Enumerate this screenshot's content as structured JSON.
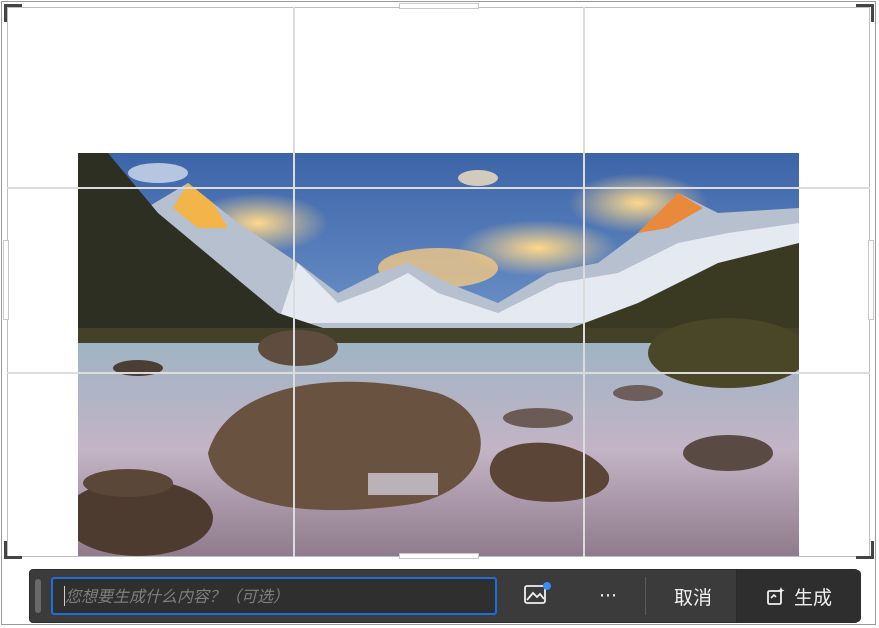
{
  "prompt": {
    "placeholder": "您想要生成什么内容？（可选）",
    "value": ""
  },
  "toolbar": {
    "reference_icon": "image-reference-icon",
    "more_icon": "more-horizontal-icon",
    "more_label": "···",
    "cancel_label": "取消",
    "generate_label": "生成",
    "generate_icon": "generate-sparkle-icon"
  },
  "colors": {
    "toolbar_bg": "#3b3b3b",
    "input_focus_border": "#1e6fd6",
    "badge_dot": "#3b8cf5",
    "grid_line": "#dcdcdc"
  }
}
